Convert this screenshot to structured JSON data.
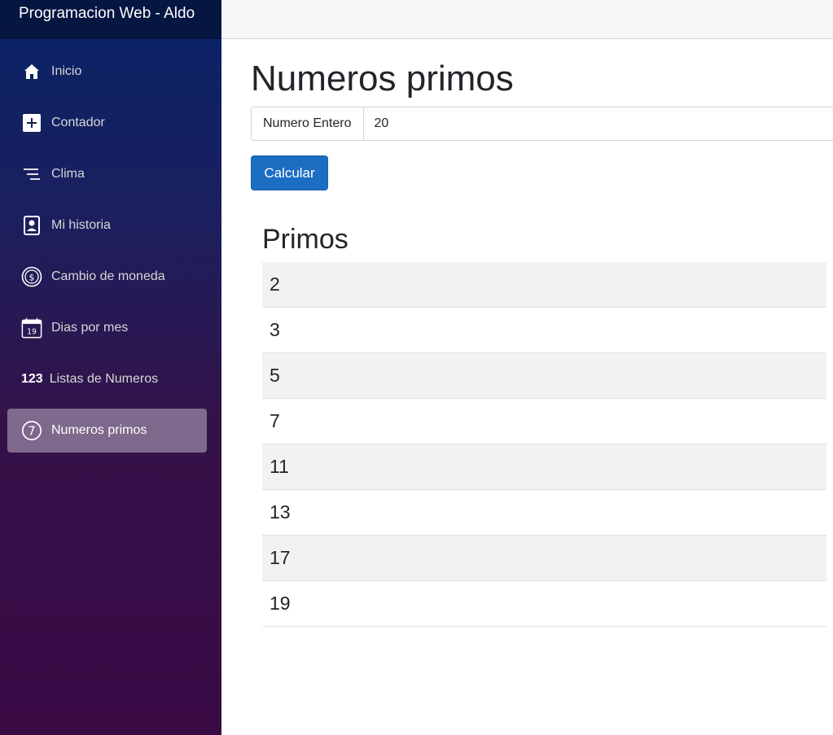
{
  "brand": "Programacion Web - Aldo",
  "nav": [
    {
      "label": "Inicio",
      "icon": "home-icon"
    },
    {
      "label": "Contador",
      "icon": "plus-icon"
    },
    {
      "label": "Clima",
      "icon": "list-icon"
    },
    {
      "label": "Mi historia",
      "icon": "person-card-icon"
    },
    {
      "label": "Cambio de moneda",
      "icon": "currency-icon"
    },
    {
      "label": "Dias por mes",
      "icon": "calendar-icon",
      "icon_text": "19"
    },
    {
      "label": "Listas de Numeros",
      "icon": "numbers-icon",
      "icon_text": "123"
    },
    {
      "label": "Numeros primos",
      "icon": "seven-circle-icon",
      "icon_text": "7",
      "active": true
    }
  ],
  "page": {
    "title": "Numeros primos",
    "input_label": "Numero Entero",
    "input_value": "20",
    "button_label": "Calcular"
  },
  "primes": {
    "title": "Primos",
    "values": [
      "2",
      "3",
      "5",
      "7",
      "11",
      "13",
      "17",
      "19"
    ]
  },
  "colors": {
    "sidebar_top": "#072366",
    "sidebar_bottom": "#3a0a45",
    "button": "#1b6ec2",
    "row_stripe": "#f2f2f2"
  }
}
